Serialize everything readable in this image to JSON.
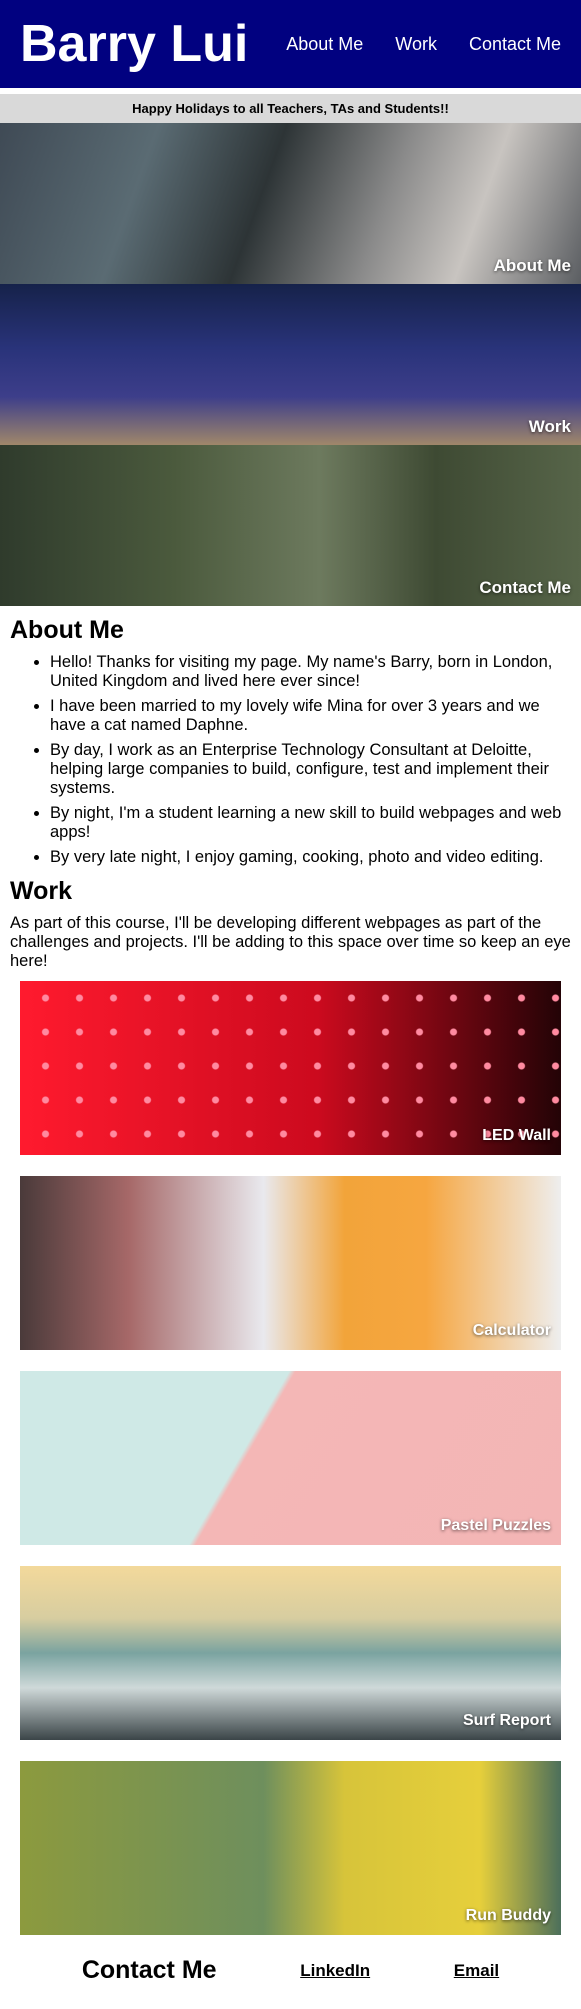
{
  "header": {
    "brand": "Barry Lui",
    "nav": [
      {
        "label": "About Me"
      },
      {
        "label": "Work"
      },
      {
        "label": "Contact Me"
      }
    ]
  },
  "notice": {
    "text": "Happy Holidays to all Teachers, TAs and Students!!"
  },
  "heroes": [
    {
      "label": "About Me"
    },
    {
      "label": "Work"
    },
    {
      "label": "Contact Me"
    }
  ],
  "about": {
    "title": "About Me",
    "items": [
      "Hello! Thanks for visiting my page. My name's Barry, born in London, United Kingdom and lived here ever since!",
      "I have been married to my lovely wife Mina for over 3 years and we have a cat named Daphne.",
      "By day, I work as an Enterprise Technology Consultant at Deloitte, helping large companies to build, configure, test and implement their systems.",
      "By night, I'm a student learning a new skill to build webpages and web apps!",
      "By very late night, I enjoy gaming, cooking, photo and video editing."
    ]
  },
  "work": {
    "title": "Work",
    "intro": "As part of this course, I'll be developing different webpages as part of the challenges and projects. I'll be adding to this space over time so keep an eye here!",
    "projects": [
      {
        "label": "LED Wall"
      },
      {
        "label": "Calculator"
      },
      {
        "label": "Pastel Puzzles"
      },
      {
        "label": "Surf Report"
      },
      {
        "label": "Run Buddy"
      }
    ]
  },
  "contact": {
    "title": "Contact Me",
    "linkedin": "LinkedIn",
    "email": "Email"
  }
}
